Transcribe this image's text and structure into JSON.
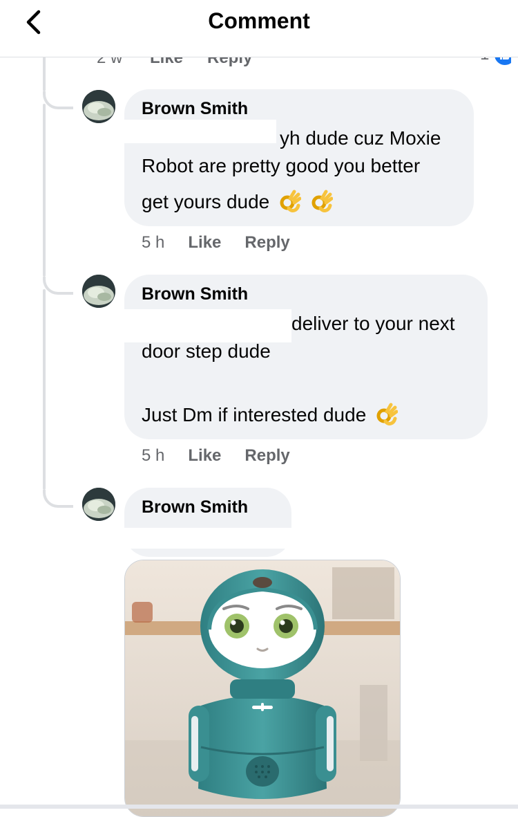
{
  "header": {
    "title": "Comment"
  },
  "previous_comment": {
    "time": "2 w",
    "like_label": "Like",
    "reply_label": "Reply",
    "reaction_count": "1"
  },
  "comments": [
    {
      "author": "Brown Smith",
      "lines": [
        "yh dude cuz Moxie",
        "Robot are pretty good you better",
        "get yours dude"
      ],
      "emoji": "ok-hand-icon x2",
      "time": "5 h",
      "like_label": "Like",
      "reply_label": "Reply"
    },
    {
      "author": "Brown Smith",
      "lines": [
        "deliver to your next",
        "door step dude",
        "Just Dm if interested dude"
      ],
      "emoji": "ok-hand-icon",
      "time": "5 h",
      "like_label": "Like",
      "reply_label": "Reply"
    },
    {
      "author": "Brown Smith",
      "attachment": "robot-photo"
    }
  ],
  "colors": {
    "bubble": "#f0f2f5",
    "meta": "#65676b",
    "thread": "#dddfe2",
    "accent": "#1877f2",
    "robot": "#3a8f91"
  }
}
